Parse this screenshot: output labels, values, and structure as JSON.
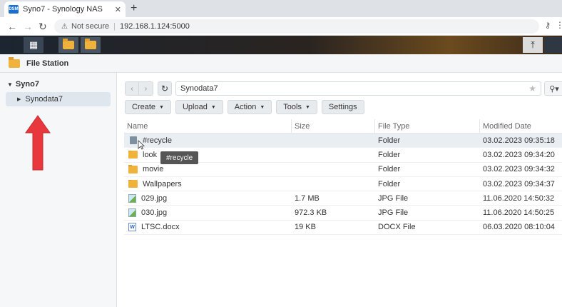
{
  "browser": {
    "tab_title": "Syno7 - Synology NAS",
    "favicon_text": "DSM",
    "new_tab": "+",
    "not_secure": "Not secure",
    "url": "192.168.1.124:5000"
  },
  "window": {
    "title": "File Station"
  },
  "sidebar": {
    "root": "Syno7",
    "items": [
      {
        "label": "Synodata7"
      }
    ]
  },
  "path": "Synodata7",
  "toolbar": {
    "create": "Create",
    "upload": "Upload",
    "action": "Action",
    "tools": "Tools",
    "settings": "Settings"
  },
  "columns": {
    "name": "Name",
    "size": "Size",
    "type": "File Type",
    "modified": "Modified Date"
  },
  "files": [
    {
      "name": "#recycle",
      "size": "",
      "type": "Folder",
      "modified": "03.02.2023 09:35:18",
      "icon": "trash-icon"
    },
    {
      "name": "look",
      "size": "",
      "type": "Folder",
      "modified": "03.02.2023 09:34:20",
      "icon": "folder-icon"
    },
    {
      "name": "movie",
      "size": "",
      "type": "Folder",
      "modified": "03.02.2023 09:34:32",
      "icon": "folder-icon"
    },
    {
      "name": "Wallpapers",
      "size": "",
      "type": "Folder",
      "modified": "03.02.2023 09:34:37",
      "icon": "folder-icon"
    },
    {
      "name": "029.jpg",
      "size": "1.7 MB",
      "type": "JPG File",
      "modified": "11.06.2020 14:50:32",
      "icon": "image-icon"
    },
    {
      "name": "030.jpg",
      "size": "972.3 KB",
      "type": "JPG File",
      "modified": "11.06.2020 14:50:25",
      "icon": "image-icon"
    },
    {
      "name": "LTSC.docx",
      "size": "19 KB",
      "type": "DOCX File",
      "modified": "06.03.2020 08:10:04",
      "icon": "docx-icon"
    }
  ],
  "tooltip": "#recycle",
  "colors": {
    "arrow": "#e8383d",
    "selection": "#dfe6ee"
  }
}
